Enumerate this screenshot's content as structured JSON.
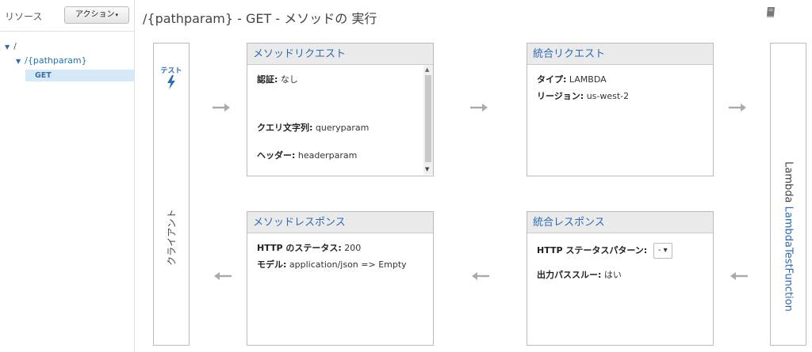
{
  "sidebar": {
    "title": "リソース",
    "actions_label": "アクション",
    "actions_caret": "▾",
    "tree_root": "/",
    "tree_path": "/{pathparam}",
    "tree_method": "GET",
    "tree_caret": "▼"
  },
  "header": {
    "path": "/{pathparam}",
    "method": "GET",
    "sep": "-",
    "title_suffix": "メソッドの 実行"
  },
  "client": {
    "test_label": "テスト",
    "label": "クライアント"
  },
  "lambda": {
    "prefix": "Lambda",
    "function": "LambdaTestFunction"
  },
  "method_request": {
    "title": "メソッドリクエスト",
    "auth_label": "認証:",
    "auth_value": "なし",
    "query_label": "クエリ文字列:",
    "query_value": "queryparam",
    "header_label": "ヘッダー:",
    "header_value": "headerparam",
    "scroll_up": "▲",
    "scroll_down": "▼"
  },
  "integration_request": {
    "title": "統合リクエスト",
    "type_label": "タイプ:",
    "type_value": "LAMBDA",
    "region_label": "リージョン:",
    "region_value": "us-west-2"
  },
  "method_response": {
    "title": "メソッドレスポンス",
    "status_label": "HTTP のステータス:",
    "status_value": "200",
    "model_label": "モデル:",
    "model_value": "application/json => Empty"
  },
  "integration_response": {
    "title": "統合レスポンス",
    "pattern_label": "HTTP ステータスパターン:",
    "pattern_value": "- ▾",
    "passthrough_label": "出力パススルー:",
    "passthrough_value": "はい"
  },
  "colors": {
    "accent": "#2a6bb3",
    "arrow": "#aaaaaa",
    "panel_header": "#eaeaea"
  }
}
